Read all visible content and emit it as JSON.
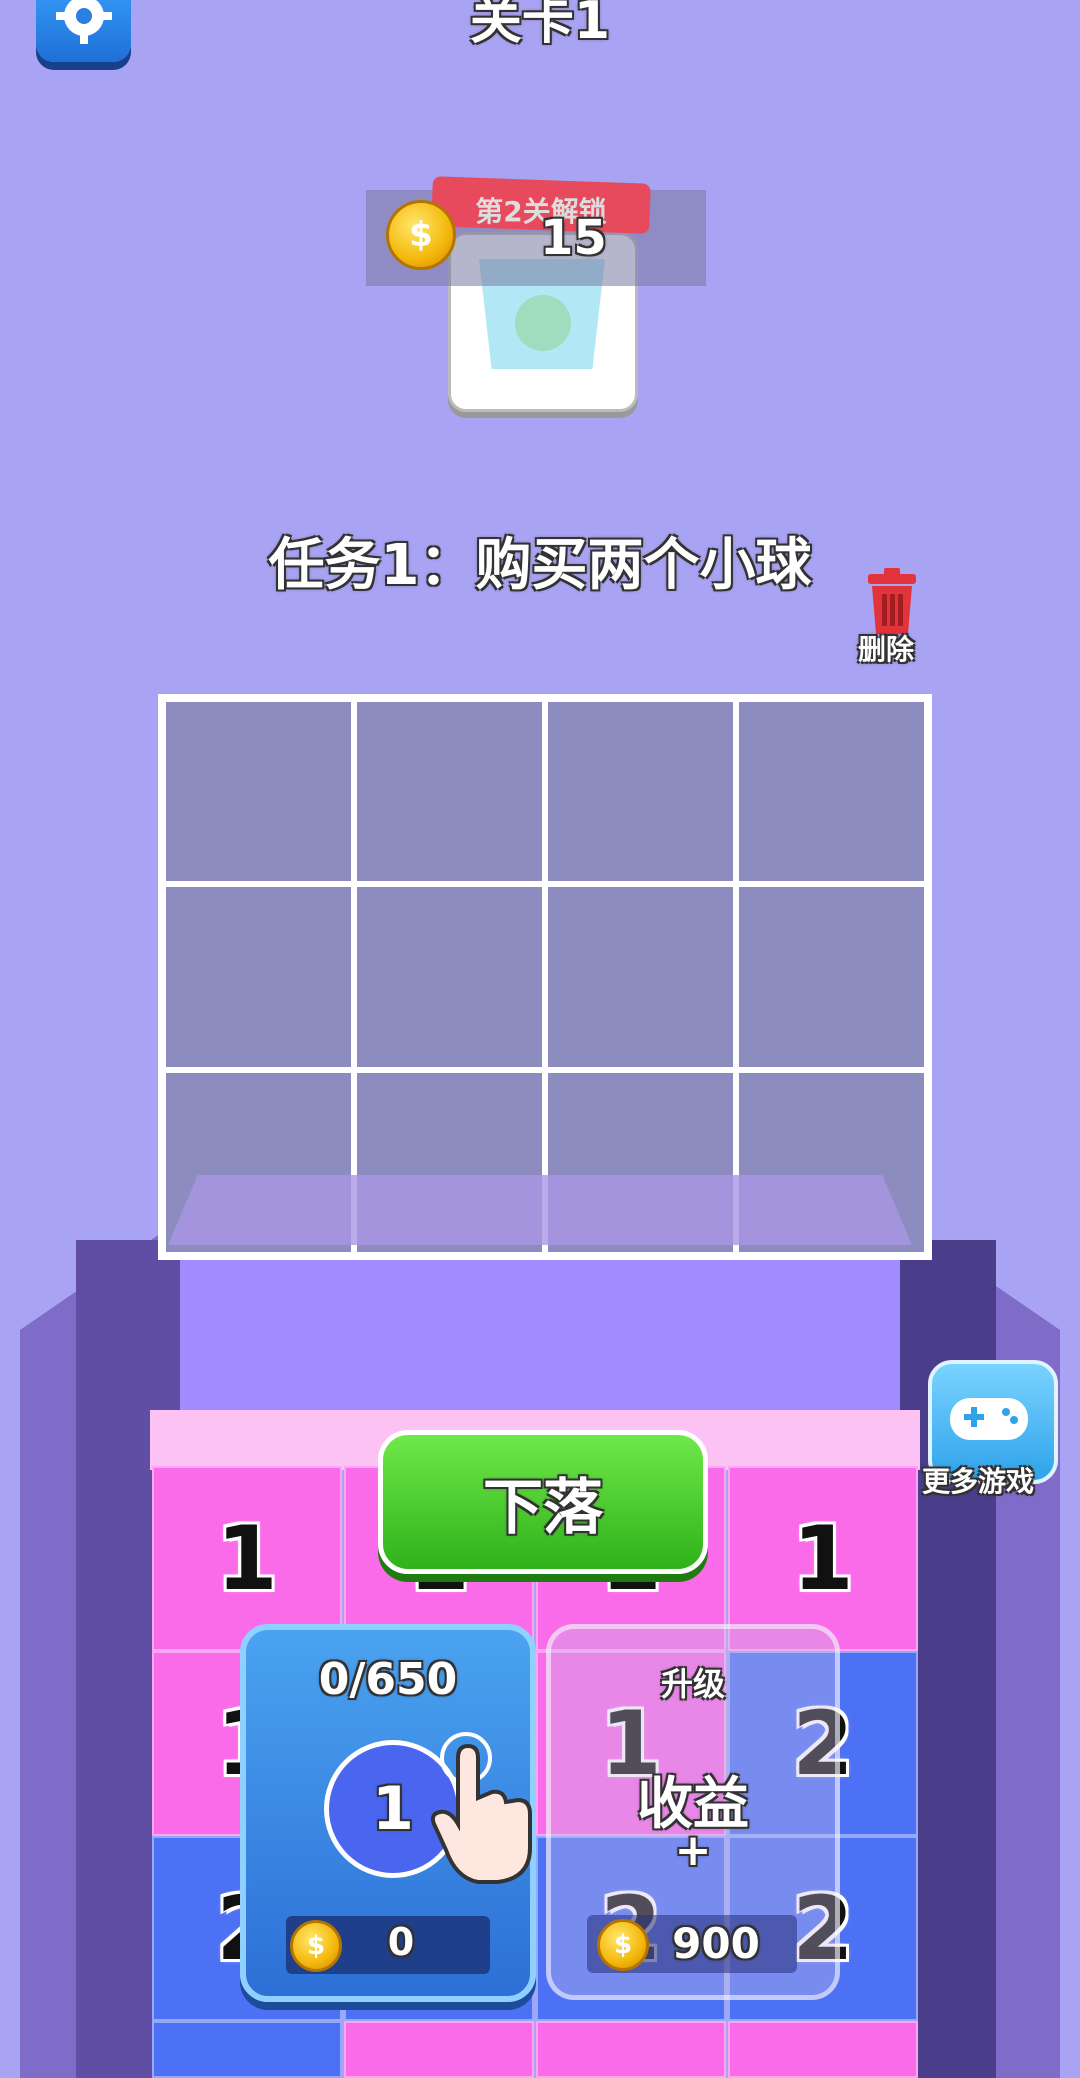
{
  "header": {
    "level_title": "关卡1"
  },
  "unlock": {
    "label": "第2关解锁",
    "cost": "15"
  },
  "task": {
    "text": "任务1：购买两个小球"
  },
  "delete": {
    "label": "删除"
  },
  "drop_button": {
    "label": "下落"
  },
  "more_games": {
    "label": "更多游戏"
  },
  "blocks": {
    "row1": [
      "1",
      "1",
      "1",
      "1"
    ],
    "row2": [
      "1",
      "",
      "1",
      "2"
    ],
    "row3": [
      "2",
      "",
      "2",
      "2"
    ]
  },
  "ball_card": {
    "progress": "0/650",
    "ball_level": "1",
    "price": "0"
  },
  "upgrade_card": {
    "title": "升级",
    "text": "收益",
    "plus": "+",
    "price": "900"
  },
  "colors": {
    "background": "#a8a3f2",
    "pink_block": "#f96be8",
    "blue_block": "#4d71f5",
    "drop_button": "#3fc42a"
  }
}
